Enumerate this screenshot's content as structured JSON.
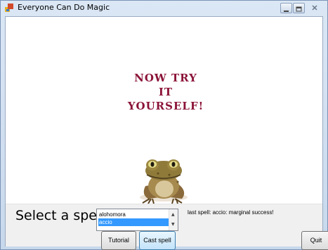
{
  "window": {
    "title": "Everyone Can Do Magic"
  },
  "content": {
    "instruction_lines": [
      "NOW TRY",
      "IT",
      "YOURSELF!"
    ],
    "image": "toad-illustration"
  },
  "controls": {
    "prompt": "Select a spell",
    "spells": [
      "alohomora",
      "accio"
    ],
    "selected_spell": "accio",
    "status": "last spell: accio: marginal success!",
    "tutorial_label": "Tutorial",
    "cast_label": "Cast spell",
    "quit_label": "Quit"
  },
  "colors": {
    "instruction": "#8b1338",
    "selection": "#3399ff"
  }
}
